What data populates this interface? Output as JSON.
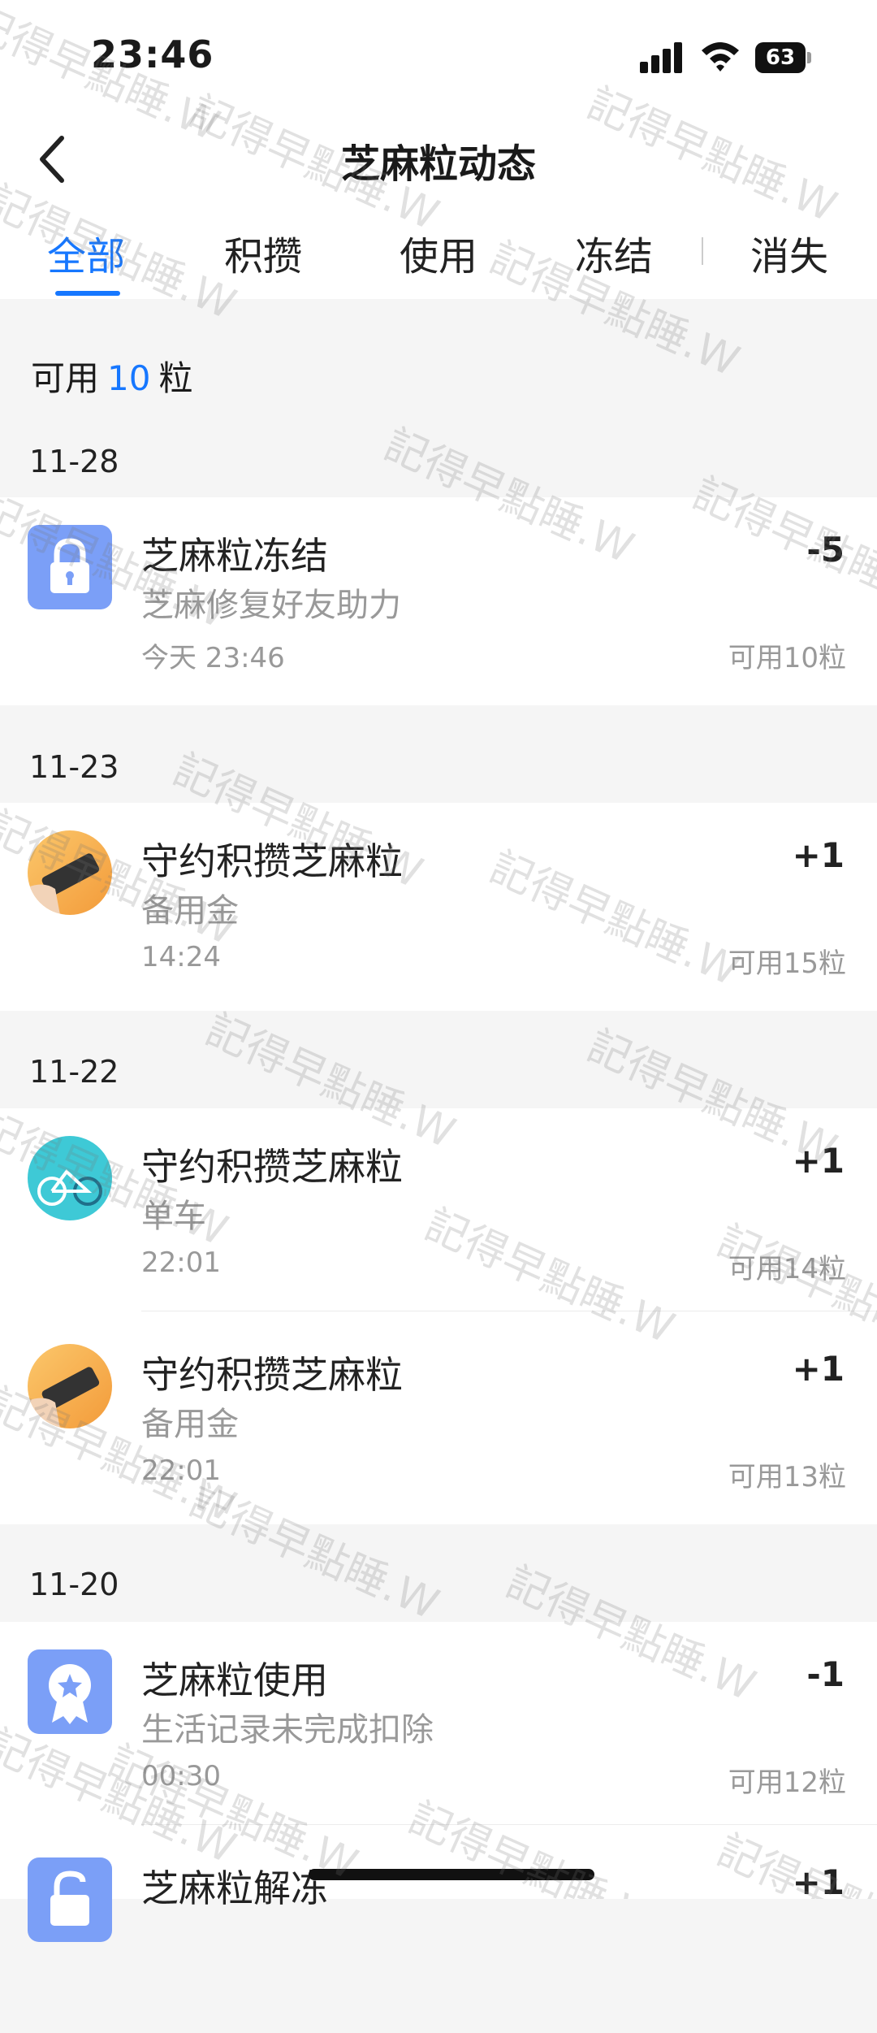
{
  "status_bar": {
    "time": "23:46",
    "battery": "63"
  },
  "nav": {
    "title": "芝麻粒动态"
  },
  "tabs": [
    "全部",
    "积攒",
    "使用",
    "冻结",
    "消失"
  ],
  "summary": {
    "prefix": "可用",
    "count": "10",
    "suffix": "粒"
  },
  "groups": [
    {
      "date": "11-28",
      "items": [
        {
          "title": "芝麻粒冻结",
          "subtitle": "芝麻修复好友助力",
          "time": "今天 23:46",
          "amount": "-5",
          "balance": "可用10粒",
          "icon": "lock-icon"
        }
      ]
    },
    {
      "date": "11-23",
      "items": [
        {
          "title": "守约积攒芝麻粒",
          "subtitle": "备用金",
          "time": "14:24",
          "amount": "+1",
          "balance": "可用15粒",
          "icon": "phone-hand-icon"
        }
      ]
    },
    {
      "date": "11-22",
      "items": [
        {
          "title": "守约积攒芝麻粒",
          "subtitle": "单车",
          "time": "22:01",
          "amount": "+1",
          "balance": "可用14粒",
          "icon": "bike-icon"
        },
        {
          "title": "守约积攒芝麻粒",
          "subtitle": "备用金",
          "time": "22:01",
          "amount": "+1",
          "balance": "可用13粒",
          "icon": "phone-hand-icon"
        }
      ]
    },
    {
      "date": "11-20",
      "items": [
        {
          "title": "芝麻粒使用",
          "subtitle": "生活记录未完成扣除",
          "time": "00:30",
          "amount": "-1",
          "balance": "可用12粒",
          "icon": "badge-icon"
        },
        {
          "title": "芝麻粒解冻",
          "subtitle": "",
          "time": "",
          "amount": "+1",
          "balance": "",
          "icon": "unlock-icon"
        }
      ]
    }
  ],
  "watermark": "記得早點睡.W",
  "colors": {
    "accent": "#1677ff",
    "icon_bg": "#7b9ff7"
  }
}
